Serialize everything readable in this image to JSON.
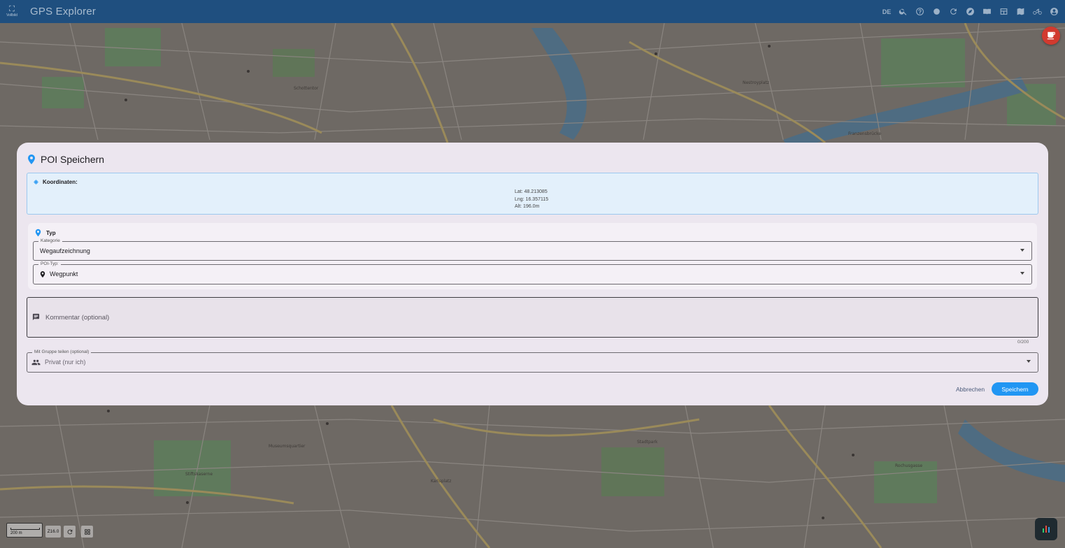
{
  "app": {
    "title": "GPS Explorer",
    "fullscreen_label": "Vollbild",
    "language": "DE"
  },
  "toolbar_icons": [
    "search-icon",
    "help-icon",
    "record-icon",
    "refresh-icon",
    "compass-icon",
    "map-book-icon",
    "layout-icon",
    "map-icon",
    "bike-icon",
    "account-icon"
  ],
  "dialog": {
    "title": "POI Speichern",
    "coords": {
      "label": "Koordinaten:",
      "lat": "Lat: 48.213085",
      "lng": "Lng: 16.357115",
      "alt": "Alt: 196.0m"
    },
    "typ": {
      "heading": "Typ",
      "kategorie_label": "Kategorie",
      "kategorie_value": "Wegaufzeichnung",
      "poi_typ_label": "POI-Typ:",
      "poi_typ_value": "Wegpunkt"
    },
    "comment": {
      "placeholder": "Kommentar (optional)",
      "counter": "0/200"
    },
    "group": {
      "label": "Mit Gruppe teilen (optional)",
      "value": "Privat (nur ich)"
    },
    "cancel_label": "Abbrechen",
    "save_label": "Speichern"
  },
  "map": {
    "scale": "200 m",
    "zoom": "Z16.0"
  },
  "colors": {
    "appbar": "#1f4f7f",
    "primary": "#2196f3",
    "dialog_bg": "#ece6ef",
    "cafe_button": "#d13a2f"
  }
}
